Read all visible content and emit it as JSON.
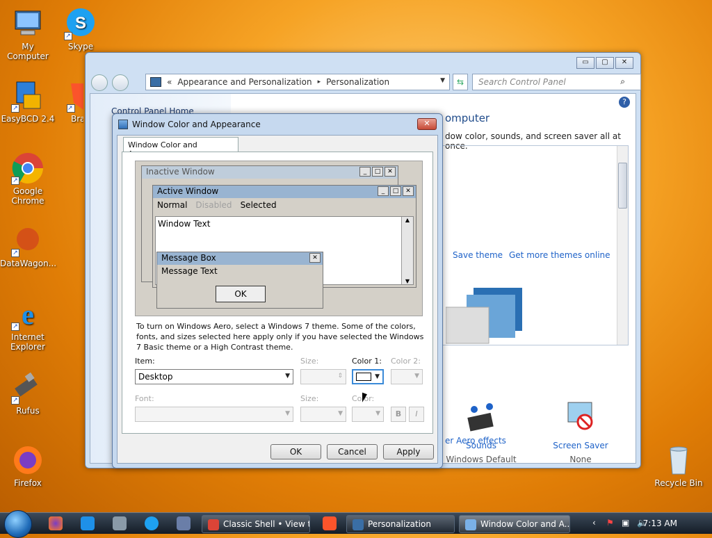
{
  "desktop_icons": [
    {
      "label": "My Computer"
    },
    {
      "label": "Skype"
    },
    {
      "label": "EasyBCD 2.4"
    },
    {
      "label": "Bra"
    },
    {
      "label": "Google Chrome"
    },
    {
      "label": "DataWagon..."
    },
    {
      "label": "Internet Explorer"
    },
    {
      "label": "Rufus"
    },
    {
      "label": "Firefox"
    },
    {
      "label": "Recycle Bin"
    }
  ],
  "personalization": {
    "caption_buttons": {
      "minimize": "▭",
      "maximize": "▢",
      "close": "✕"
    },
    "address_prefix": "«",
    "breadcrumb": [
      "Appearance and Personalization",
      "Personalization"
    ],
    "breadcrumb_separator": "▸",
    "search_placeholder": "Search Control Panel",
    "left_link": "Control Panel Home",
    "heading_partial": "omputer",
    "description_partial": "dow color, sounds, and screen saver all at once.",
    "save_theme": "Save theme",
    "get_more_themes": "Get more themes online",
    "sounds": {
      "label": "Sounds",
      "value": "Windows Default"
    },
    "screen_saver": {
      "label": "Screen Saver",
      "value": "None"
    },
    "aero_link_partial": "er Aero effects"
  },
  "dialog": {
    "title": "Window Color and Appearance",
    "close": "✕",
    "tab": "Window Color and Appearance",
    "preview": {
      "inactive_title": "Inactive Window",
      "active_title": "Active Window",
      "menu_normal": "Normal",
      "menu_disabled": "Disabled",
      "menu_selected": "Selected",
      "window_text": "Window Text",
      "msgbox_title": "Message Box",
      "msgbox_text": "Message Text",
      "msgbox_ok": "OK"
    },
    "info": "To turn on Windows Aero, select a Windows 7 theme.  Some of the colors, fonts, and sizes selected here apply only if you have selected the Windows 7 Basic theme or a High Contrast theme.",
    "item_label": "Item:",
    "item_value": "Desktop",
    "size_label": "Size:",
    "color1_label": "Color 1:",
    "color2_label": "Color 2:",
    "font_label": "Font:",
    "font_size_label": "Size:",
    "font_color_label": "Color:",
    "bold": "B",
    "italic": "I",
    "ok": "OK",
    "cancel": "Cancel",
    "apply": "Apply"
  },
  "taskbar": {
    "tasks": [
      {
        "label": "Classic Shell • View t..."
      },
      {
        "label": "Personalization"
      },
      {
        "label": "Window Color and A..."
      }
    ],
    "clock": "7:13 AM"
  }
}
